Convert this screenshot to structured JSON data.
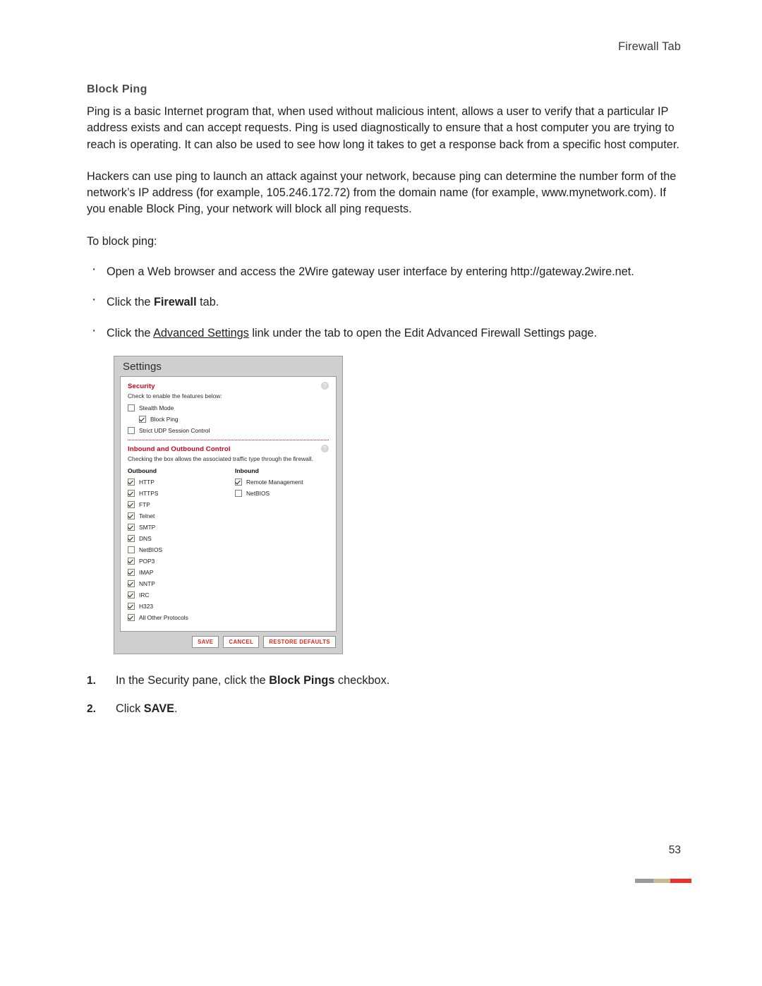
{
  "header": {
    "running_head": "Firewall Tab"
  },
  "section": {
    "title": "Block Ping"
  },
  "paragraphs": {
    "p1": "Ping is a basic Internet program that, when used without malicious intent, allows a user to verify that a particular IP address exists and can accept requests. Ping is used diagnostically to ensure that a host computer you are trying to reach is operating. It can also be used to see how long it takes to get a response back from a specific host computer.",
    "p2": "Hackers can use ping to launch an attack against your network, because ping can determine the number form of the network’s IP address (for example, 105.246.172.72) from the domain name (for example, www.mynetwork.com). If you enable Block Ping, your network will block all ping requests.",
    "lead_in": "To block ping:"
  },
  "bullets": [
    {
      "text_before": "Open a Web browser and access the 2Wire gateway user interface by entering http://gateway.2wire.net."
    },
    {
      "text_before": "Click the ",
      "bold": "Firewall",
      "text_after": " tab."
    },
    {
      "text_before": "Click the ",
      "underline": "Advanced Settings",
      "text_after": " link under the tab to open the Edit Advanced Firewall Settings page."
    }
  ],
  "steps": [
    {
      "num": "1.",
      "text_before": "In the Security pane, click the ",
      "bold": "Block Pings",
      "text_after": " checkbox."
    },
    {
      "num": "2.",
      "text_before": "Click ",
      "bold": "SAVE",
      "text_after": "."
    }
  ],
  "screenshot": {
    "title": "Settings",
    "security": {
      "heading": "Security",
      "help_icon": "?",
      "subtitle": "Check to enable the features below:",
      "options": [
        {
          "label": "Stealth Mode",
          "checked": false,
          "indent": false
        },
        {
          "label": "Block Ping",
          "checked": true,
          "indent": true
        },
        {
          "label": "Strict UDP Session Control",
          "checked": false,
          "indent": false
        }
      ]
    },
    "traffic": {
      "heading": "Inbound and Outbound Control",
      "help_icon": "?",
      "subtitle": "Checking the box allows the associated traffic type through the firewall.",
      "outbound_header": "Outbound",
      "inbound_header": "Inbound",
      "outbound": [
        {
          "label": "HTTP",
          "checked": true
        },
        {
          "label": "HTTPS",
          "checked": true
        },
        {
          "label": "FTP",
          "checked": true
        },
        {
          "label": "Telnet",
          "checked": true
        },
        {
          "label": "SMTP",
          "checked": true
        },
        {
          "label": "DNS",
          "checked": true
        },
        {
          "label": "NetBIOS",
          "checked": false
        },
        {
          "label": "POP3",
          "checked": true
        },
        {
          "label": "IMAP",
          "checked": true
        },
        {
          "label": "NNTP",
          "checked": true
        },
        {
          "label": "IRC",
          "checked": true
        },
        {
          "label": "H323",
          "checked": true
        },
        {
          "label": "All Other Protocols",
          "checked": true
        }
      ],
      "inbound": [
        {
          "label": "Remote Management",
          "checked": true
        },
        {
          "label": "NetBIOS",
          "checked": false
        }
      ]
    },
    "buttons": [
      {
        "label": "SAVE"
      },
      {
        "label": "CANCEL"
      },
      {
        "label": "RESTORE DEFAULTS"
      }
    ]
  },
  "footer": {
    "page_number": "53",
    "bar_colors": [
      "#9a9a9e",
      "#c8bc94",
      "#f0302a"
    ]
  }
}
